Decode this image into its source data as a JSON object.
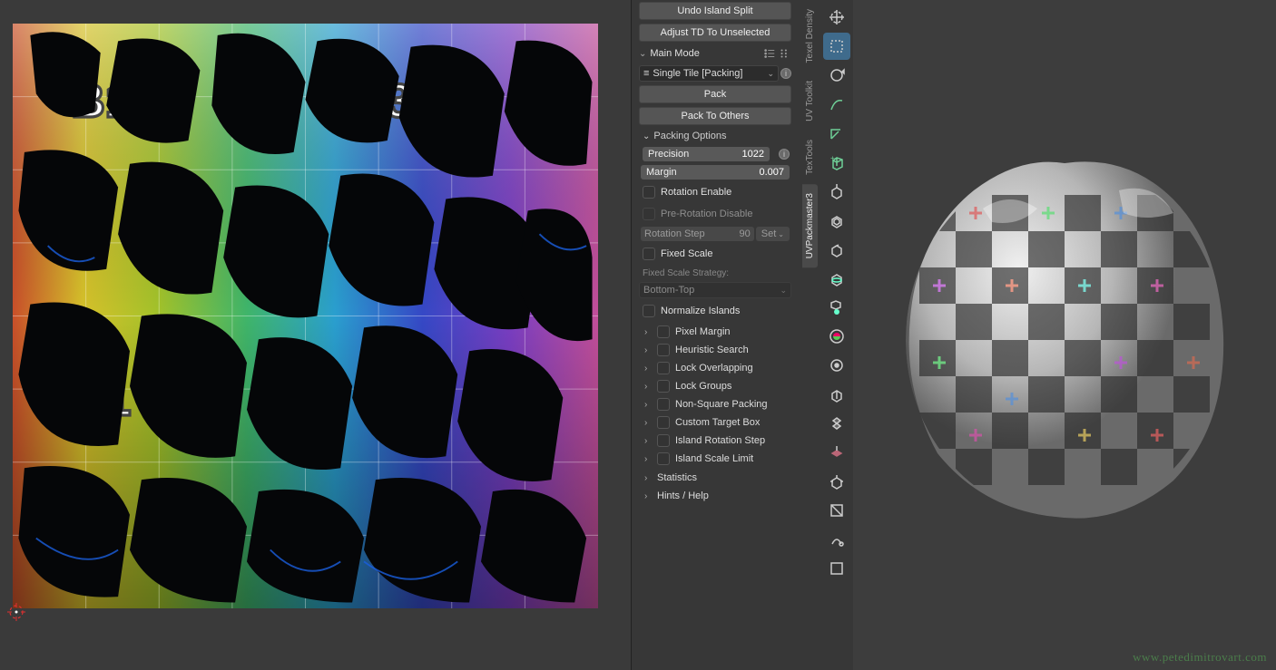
{
  "top_buttons": {
    "undo_split": "Undo Island Split",
    "adjust_td": "Adjust TD To Unselected"
  },
  "main_mode": {
    "header": "Main Mode",
    "dropdown": "Single Tile [Packing]",
    "pack_btn": "Pack",
    "pack_others_btn": "Pack To Others"
  },
  "packing": {
    "header": "Packing Options",
    "precision_label": "Precision",
    "precision_val": "1022",
    "margin_label": "Margin",
    "margin_val": "0.007",
    "rotation_enable": "Rotation Enable",
    "pre_rotation_disable": "Pre-Rotation Disable",
    "rotation_step_label": "Rotation Step",
    "rotation_step_val": "90",
    "rotation_step_set": "Set",
    "fixed_scale": "Fixed Scale",
    "fixed_scale_strategy_label": "Fixed Scale Strategy:",
    "fixed_scale_strategy_val": "Bottom-Top",
    "normalize_islands": "Normalize Islands"
  },
  "subpanels": [
    "Pixel Margin",
    "Heuristic Search",
    "Lock Overlapping",
    "Lock Groups",
    "Non-Square Packing",
    "Custom Target Box",
    "Island Rotation Step",
    "Island Scale Limit"
  ],
  "bottom_panels": {
    "statistics": "Statistics",
    "hints": "Hints / Help"
  },
  "vtabs": [
    {
      "label": "Texel Density",
      "active": false
    },
    {
      "label": "UV Toolkit",
      "active": false
    },
    {
      "label": "TexTools",
      "active": false
    },
    {
      "label": "UVPackmaster3",
      "active": true
    }
  ],
  "tools": [
    {
      "name": "cursor",
      "active": false
    },
    {
      "name": "select",
      "active": true,
      "group": "sel"
    },
    {
      "name": "rotate-manip",
      "active": false
    },
    {
      "name": "annotate",
      "kind": "green"
    },
    {
      "name": "measure",
      "kind": "green"
    },
    {
      "name": "add-cube",
      "kind": "green"
    },
    {
      "name": "extrude"
    },
    {
      "name": "inset"
    },
    {
      "name": "bevel"
    },
    {
      "name": "loop-cut"
    },
    {
      "name": "knife"
    },
    {
      "name": "poly-build"
    },
    {
      "name": "spin"
    },
    {
      "name": "smooth"
    },
    {
      "name": "edge-slide"
    },
    {
      "name": "transform"
    },
    {
      "name": "shrink"
    },
    {
      "name": "shear"
    },
    {
      "name": "rip"
    },
    {
      "name": "region"
    }
  ],
  "watermark": "www.petedimitrovart.com",
  "icons": {
    "chevron_down": "⌄",
    "chevron_right": "›",
    "list_options": "list",
    "dots": "⋮"
  }
}
